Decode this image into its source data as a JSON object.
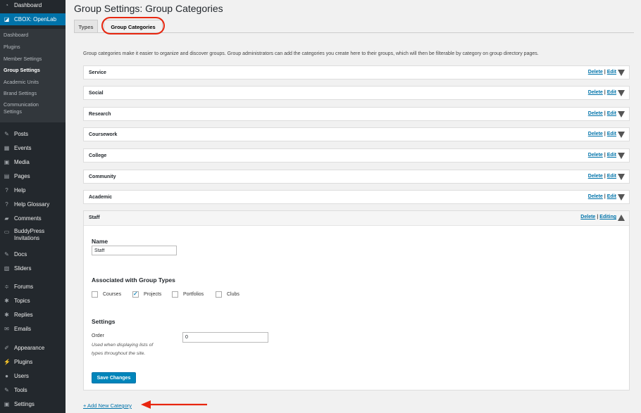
{
  "sidebar": {
    "top": [
      {
        "label": "Dashboard",
        "icon": "dashboard-icon"
      },
      {
        "label": "CBOX: OpenLab",
        "icon": "openlab-icon"
      }
    ],
    "submenu": [
      {
        "label": "Dashboard",
        "current": false
      },
      {
        "label": "Plugins",
        "current": false
      },
      {
        "label": "Member Settings",
        "current": false
      },
      {
        "label": "Group Settings",
        "current": true
      },
      {
        "label": "Academic Units",
        "current": false
      },
      {
        "label": "Brand Settings",
        "current": false
      },
      {
        "label": "Communication Settings",
        "current": false
      }
    ],
    "items": [
      {
        "label": "Posts",
        "icon": "pushpin-icon"
      },
      {
        "label": "Events",
        "icon": "calendar-icon"
      },
      {
        "label": "Media",
        "icon": "media-icon"
      },
      {
        "label": "Pages",
        "icon": "pages-icon"
      },
      {
        "label": "Help",
        "icon": "help-icon"
      },
      {
        "label": "Help Glossary",
        "icon": "help-icon"
      },
      {
        "label": "Comments",
        "icon": "comment-icon"
      },
      {
        "label": "BuddyPress Invitations",
        "icon": "invite-icon"
      },
      {
        "label": "Docs",
        "icon": "pushpin-icon"
      },
      {
        "label": "Sliders",
        "icon": "slider-icon"
      },
      {
        "label": "Forums",
        "icon": "forum-icon"
      },
      {
        "label": "Topics",
        "icon": "topics-icon"
      },
      {
        "label": "Replies",
        "icon": "replies-icon"
      },
      {
        "label": "Emails",
        "icon": "email-icon"
      },
      {
        "label": "Appearance",
        "icon": "appearance-icon"
      },
      {
        "label": "Plugins",
        "icon": "plugin-icon"
      },
      {
        "label": "Users",
        "icon": "users-icon"
      },
      {
        "label": "Tools",
        "icon": "tools-icon"
      },
      {
        "label": "Settings",
        "icon": "settings-icon"
      }
    ]
  },
  "page": {
    "title": "Group Settings: Group Categories",
    "tabs": [
      "Types",
      "Group Categories"
    ],
    "description": "Group categories make it easier to organize and discover groups. Group administrators can add the categories you create here to their groups, which will then be filterable by category on group directory pages."
  },
  "categories": [
    {
      "name": "Service",
      "delete": "Delete",
      "edit": "Edit"
    },
    {
      "name": "Social",
      "delete": "Delete",
      "edit": "Edit"
    },
    {
      "name": "Research",
      "delete": "Delete",
      "edit": "Edit"
    },
    {
      "name": "Coursework",
      "delete": "Delete",
      "edit": "Edit"
    },
    {
      "name": "College",
      "delete": "Delete",
      "edit": "Edit"
    },
    {
      "name": "Community",
      "delete": "Delete",
      "edit": "Edit"
    },
    {
      "name": "Academic",
      "delete": "Delete",
      "edit": "Edit"
    }
  ],
  "staff": {
    "name": "Staff",
    "delete": "Delete",
    "editing": "Editing",
    "name_label": "Name",
    "name_value": "Staff",
    "types_label": "Associated with Group Types",
    "types": [
      {
        "label": "Courses",
        "checked": false
      },
      {
        "label": "Projects",
        "checked": true
      },
      {
        "label": "Portfolios",
        "checked": false
      },
      {
        "label": "Clubs",
        "checked": false
      }
    ],
    "settings_label": "Settings",
    "order_label": "Order",
    "order_help_1": "Used when displaying lists of",
    "order_help_2": "types throughout the site.",
    "order_value": "0",
    "save_label": "Save Changes"
  },
  "add_new": "+ Add New Category",
  "colors": {
    "accent": "#0073aa",
    "highlight": "#e8260f"
  }
}
